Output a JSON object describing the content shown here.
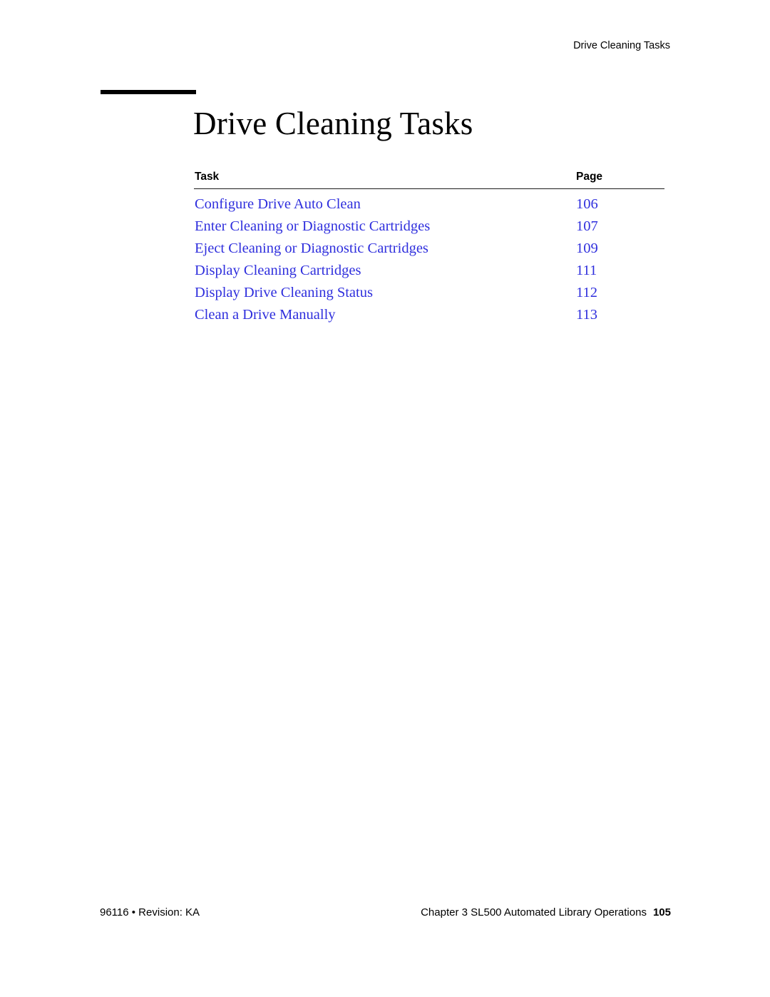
{
  "colors": {
    "link": "#2f2fdd",
    "text": "#000000",
    "rule": "#1c1c1c",
    "background": "#ffffff"
  },
  "header": {
    "running_head": "Drive Cleaning Tasks"
  },
  "title": {
    "text": "Drive Cleaning Tasks"
  },
  "table": {
    "columns": {
      "task": "Task",
      "page": "Page"
    },
    "rows": [
      {
        "task": "Configure Drive Auto Clean",
        "page": "106"
      },
      {
        "task": "Enter Cleaning or Diagnostic Cartridges",
        "page": "107"
      },
      {
        "task": "Eject Cleaning or Diagnostic Cartridges",
        "page": "109"
      },
      {
        "task": "Display Cleaning Cartridges",
        "page": "111"
      },
      {
        "task": "Display Drive Cleaning Status",
        "page": "112"
      },
      {
        "task": "Clean a Drive Manually",
        "page": "113"
      }
    ]
  },
  "footer": {
    "left": "96116 • Revision: KA",
    "chapter": "Chapter 3 SL500 Automated Library Operations",
    "page_number": "105"
  }
}
